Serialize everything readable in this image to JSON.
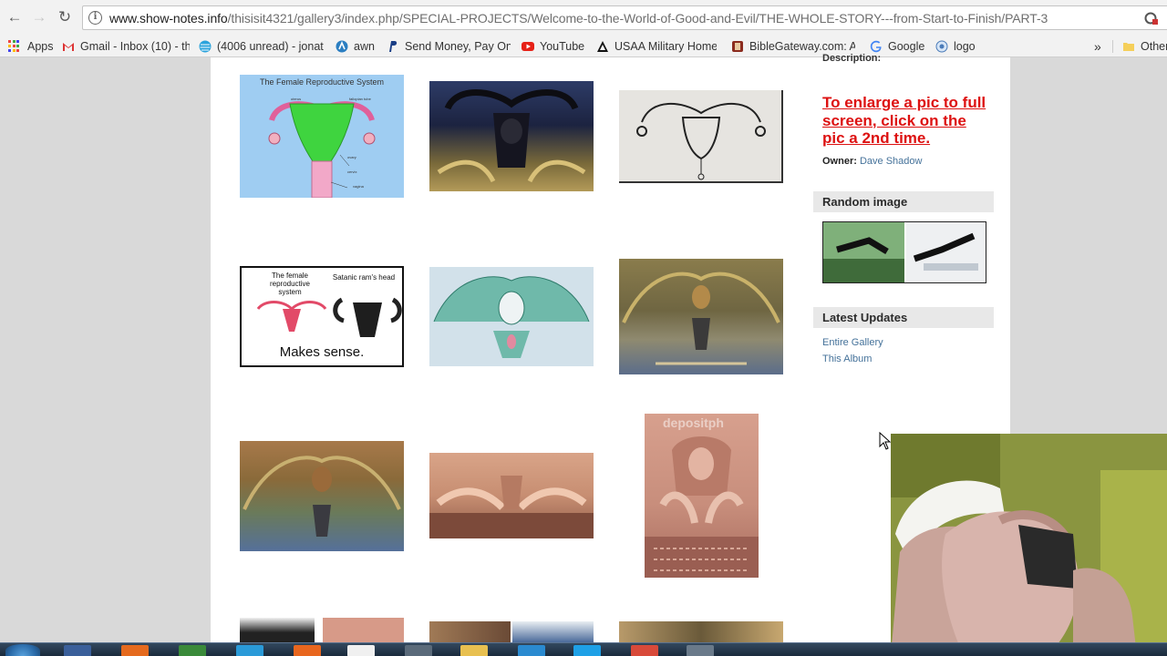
{
  "browser": {
    "url_host": "www.show-notes.info",
    "url_path": "/thisisit4321/gallery3/index.php/SPECIAL-PROJECTS/Welcome-to-the-World-of-Good-and-Evil/THE-WHOLE-STORY---from-Start-to-Finish/PART-3",
    "bookmarks": [
      {
        "label": "Apps",
        "icon": "apps-icon"
      },
      {
        "label": "Gmail - Inbox (10) - th",
        "icon": "gmail-icon"
      },
      {
        "label": "(4006 unread) - jonat",
        "icon": "att-icon"
      },
      {
        "label": "awn",
        "icon": "awn-icon"
      },
      {
        "label": "Send Money, Pay Onli",
        "icon": "paypal-icon"
      },
      {
        "label": "YouTube",
        "icon": "youtube-icon"
      },
      {
        "label": "USAA Military Home,",
        "icon": "usaa-icon"
      },
      {
        "label": "BibleGateway.com: A",
        "icon": "biblegateway-icon"
      },
      {
        "label": "Google",
        "icon": "google-icon"
      },
      {
        "label": "logo",
        "icon": "globe-icon"
      },
      {
        "label": "Other",
        "icon": "folder-icon"
      }
    ],
    "overflow_label": "»"
  },
  "gallery": {
    "images": [
      {
        "title": "The Female Reproductive System",
        "labels": [
          "uterus",
          "fallopian tube",
          "ovary",
          "cervix",
          "vagina"
        ]
      },
      {
        "title": ""
      },
      {
        "title": ""
      },
      {
        "title": "",
        "left_caption": "The female reproductive system",
        "right_caption": "Satanic ram's head",
        "bottom_caption": "Makes sense."
      },
      {
        "title": ""
      },
      {
        "title": ""
      },
      {
        "title": ""
      },
      {
        "title": ""
      },
      {
        "title": "",
        "watermark": "depositph"
      }
    ]
  },
  "sidebar": {
    "description_label": "Description:",
    "enlarge_text": "To enlarge a pic to full screen, click on the pic a 2nd time.",
    "owner_label": "Owner:",
    "owner_name": "Dave Shadow",
    "random_heading": "Random image",
    "latest_heading": "Latest Updates",
    "links": [
      "Entire Gallery",
      "This Album"
    ]
  },
  "colors": {
    "link": "#45729a",
    "enlarge": "#dd1111",
    "sidebar_head_bg": "#e8e8e8",
    "page_bg": "#d9d9d9"
  }
}
